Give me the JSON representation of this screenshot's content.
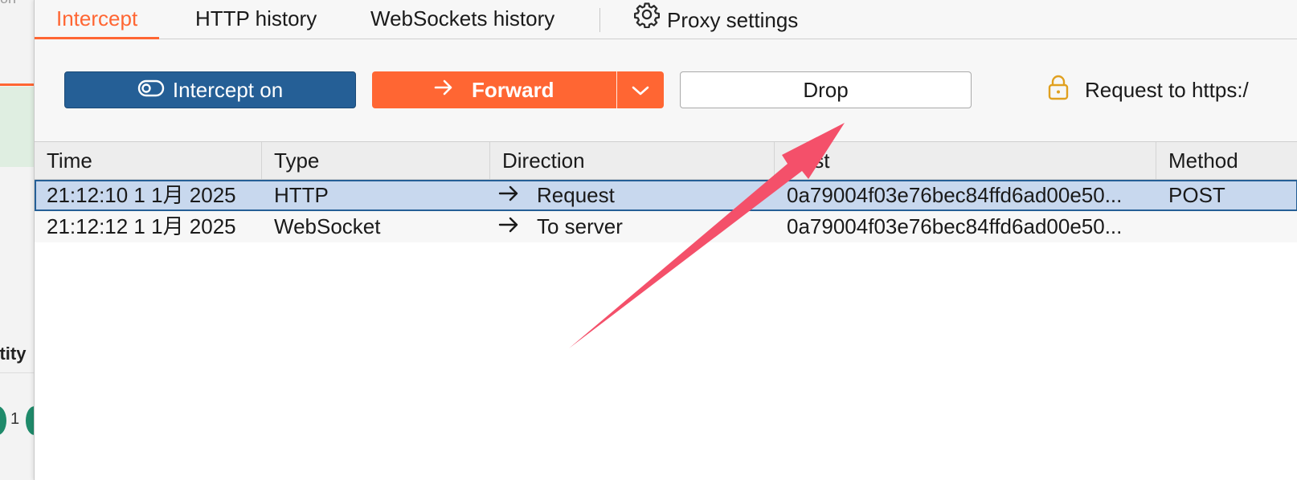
{
  "background_window": {
    "top_text": "on",
    "entity_text": "ntity",
    "number_text": "1"
  },
  "tabs": [
    {
      "label": "Intercept",
      "active": true
    },
    {
      "label": "HTTP history",
      "active": false
    },
    {
      "label": "WebSockets history",
      "active": false
    },
    {
      "label": "Proxy settings",
      "active": false,
      "icon": "gear-icon"
    }
  ],
  "toolbar": {
    "intercept_label": "Intercept on",
    "forward_label": "Forward",
    "drop_label": "Drop",
    "request_info": "Request to https:/"
  },
  "table": {
    "columns": [
      "Time",
      "Type",
      "Direction",
      "Host",
      "Method"
    ],
    "rows": [
      {
        "time": "21:12:10 1 1月 2025",
        "type": "HTTP",
        "direction": "Request",
        "host": "0a79004f03e76bec84ffd6ad00e50...",
        "method": "POST",
        "selected": true
      },
      {
        "time": "21:12:12 1 1月 2025",
        "type": "WebSocket",
        "direction": "To server",
        "host": "0a79004f03e76bec84ffd6ad00e50...",
        "method": "",
        "selected": false
      }
    ]
  },
  "colors": {
    "accent_orange": "#ff6633",
    "intercept_blue": "#255f96",
    "selection": "#c8d8ee",
    "annotation_arrow": "#f4506a"
  }
}
